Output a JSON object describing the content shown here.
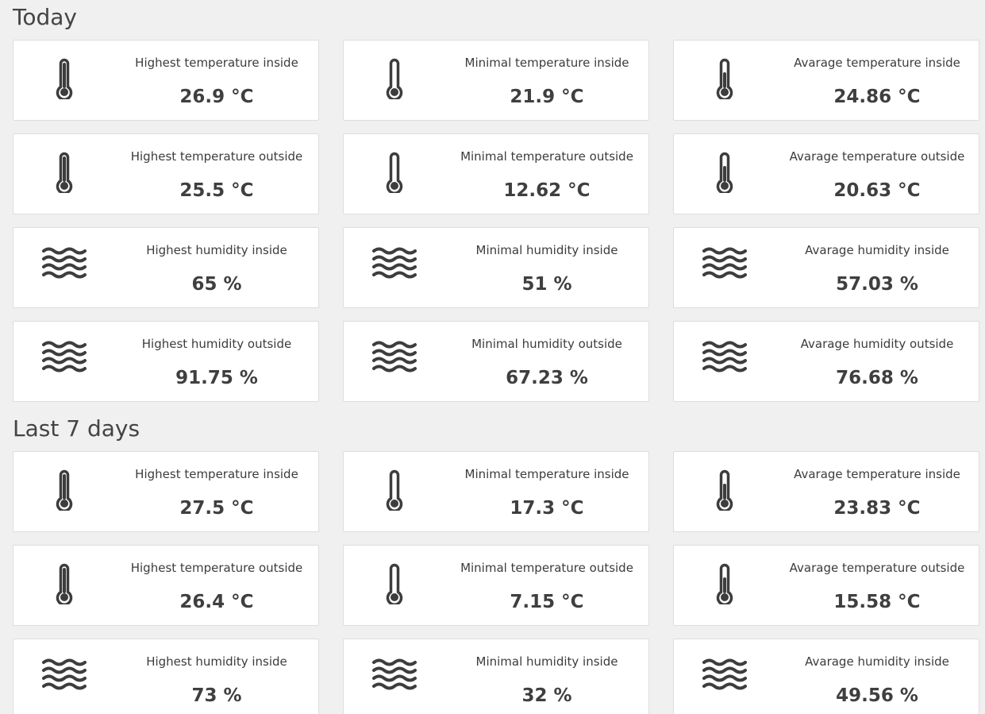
{
  "sections": [
    {
      "title": "Today",
      "cards": [
        {
          "icon": "thermometer-high-icon",
          "label": "Highest temperature inside",
          "value": "26.9 °C"
        },
        {
          "icon": "thermometer-low-icon",
          "label": "Minimal temperature inside",
          "value": "21.9 °C"
        },
        {
          "icon": "thermometer-half-icon",
          "label": "Avarage temperature inside",
          "value": "24.86 °C"
        },
        {
          "icon": "thermometer-high-icon",
          "label": "Highest temperature outside",
          "value": "25.5 °C"
        },
        {
          "icon": "thermometer-low-icon",
          "label": "Minimal temperature outside",
          "value": "12.62 °C"
        },
        {
          "icon": "thermometer-half-icon",
          "label": "Avarage temperature outside",
          "value": "20.63 °C"
        },
        {
          "icon": "humidity-waves-icon",
          "label": "Highest humidity inside",
          "value": "65 %"
        },
        {
          "icon": "humidity-waves-icon",
          "label": "Minimal humidity inside",
          "value": "51 %"
        },
        {
          "icon": "humidity-waves-icon",
          "label": "Avarage humidity inside",
          "value": "57.03 %"
        },
        {
          "icon": "humidity-waves-icon",
          "label": "Highest humidity outside",
          "value": "91.75 %"
        },
        {
          "icon": "humidity-waves-icon",
          "label": "Minimal humidity outside",
          "value": "67.23 %"
        },
        {
          "icon": "humidity-waves-icon",
          "label": "Avarage humidity outside",
          "value": "76.68 %"
        }
      ]
    },
    {
      "title": "Last 7 days",
      "cards": [
        {
          "icon": "thermometer-high-icon",
          "label": "Highest temperature inside",
          "value": "27.5 °C"
        },
        {
          "icon": "thermometer-low-icon",
          "label": "Minimal temperature inside",
          "value": "17.3 °C"
        },
        {
          "icon": "thermometer-half-icon",
          "label": "Avarage temperature inside",
          "value": "23.83 °C"
        },
        {
          "icon": "thermometer-high-icon",
          "label": "Highest temperature outside",
          "value": "26.4 °C"
        },
        {
          "icon": "thermometer-low-icon",
          "label": "Minimal temperature outside",
          "value": "7.15 °C"
        },
        {
          "icon": "thermometer-half-icon",
          "label": "Avarage temperature outside",
          "value": "15.58 °C"
        },
        {
          "icon": "humidity-waves-icon",
          "label": "Highest humidity inside",
          "value": "73 %"
        },
        {
          "icon": "humidity-waves-icon",
          "label": "Minimal humidity inside",
          "value": "32 %"
        },
        {
          "icon": "humidity-waves-icon",
          "label": "Avarage humidity inside",
          "value": "49.56 %"
        }
      ]
    }
  ],
  "colors": {
    "background": "#f0f0f0",
    "card": "#ffffff",
    "card_border": "#dddddd",
    "icon": "#3d3d3d",
    "text": "#444444"
  }
}
